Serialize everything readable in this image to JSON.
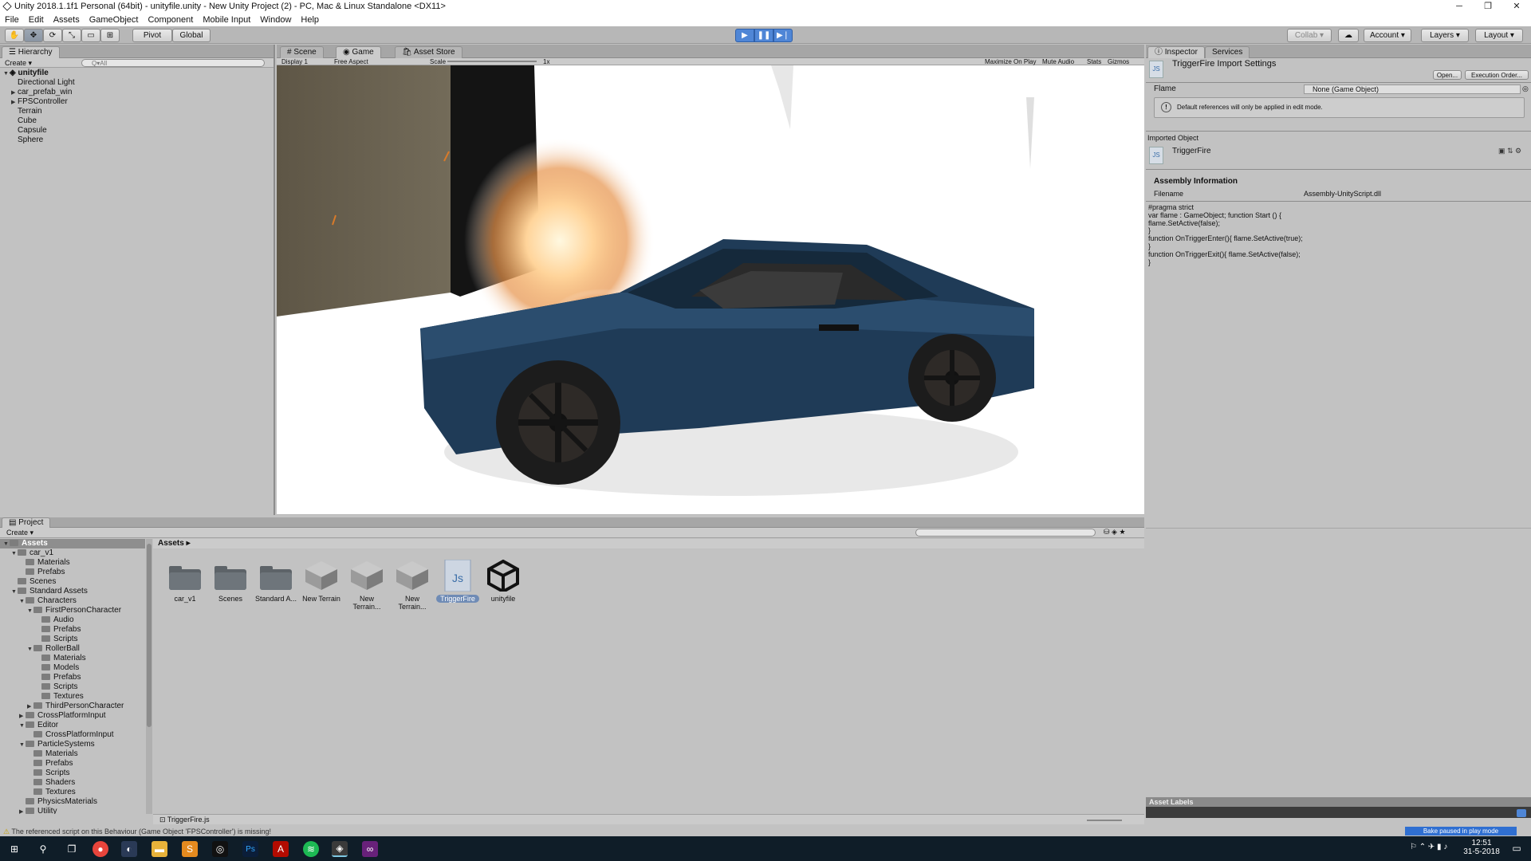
{
  "window": {
    "title": "Unity 2018.1.1f1 Personal (64bit) - unityfile.unity - New Unity Project (2) - PC, Mac & Linux Standalone <DX11>",
    "minimize": "─",
    "restore": "❐",
    "close": "✕"
  },
  "menu": [
    "File",
    "Edit",
    "Assets",
    "GameObject",
    "Component",
    "Mobile Input",
    "Window",
    "Help"
  ],
  "toolbar": {
    "pivot": "Pivot",
    "global": "Global",
    "collab": "Collab ▾",
    "account": "Account",
    "layers": "Layers",
    "layout": "Layout"
  },
  "hierarchy": {
    "tab": "Hierarchy",
    "create": "Create ▾",
    "search_placeholder": "Q▾All",
    "scene": "unityfile",
    "items": [
      {
        "label": "Directional Light",
        "expandable": false
      },
      {
        "label": "car_prefab_win",
        "expandable": true
      },
      {
        "label": "FPSController",
        "expandable": true
      },
      {
        "label": "Terrain",
        "expandable": false
      },
      {
        "label": "Cube",
        "expandable": false
      },
      {
        "label": "Capsule",
        "expandable": false
      },
      {
        "label": "Sphere",
        "expandable": false
      }
    ]
  },
  "scene_tabs": {
    "scene": "Scene",
    "game": "Game",
    "asset_store": "Asset Store"
  },
  "game_bar": {
    "display": "Display 1",
    "aspect": "Free Aspect",
    "scale_label": "Scale",
    "scale_value": "1x",
    "maximize": "Maximize On Play",
    "mute": "Mute Audio",
    "stats": "Stats",
    "gizmos": "Gizmos"
  },
  "inspector": {
    "tab": "Inspector",
    "services_tab": "Services",
    "title": "TriggerFire Import Settings",
    "open": "Open...",
    "exec_order": "Execution Order...",
    "flame_label": "Flame",
    "flame_value": "None (Game Object)",
    "info": "Default references will only be applied in edit mode.",
    "imported_object": "Imported Object",
    "object_name": "TriggerFire",
    "assembly_header": "Assembly Information",
    "filename_label": "Filename",
    "filename_value": "Assembly-UnityScript.dll",
    "code": "#pragma strict\nvar flame : GameObject; function Start () {\nflame.SetActive(false);\n}\nfunction OnTriggerEnter(){ flame.SetActive(true);\n}\nfunction OnTriggerExit(){ flame.SetActive(false);\n}",
    "asset_labels": "Asset Labels",
    "bake": "Bake paused in play mode"
  },
  "project": {
    "tab": "Project",
    "create": "Create ▾",
    "breadcrumb": "Assets ▸",
    "selected_file": "TriggerFire.js",
    "tree": [
      {
        "label": "Assets",
        "depth": 0,
        "arrow": "▼",
        "selected": true
      },
      {
        "label": "car_v1",
        "depth": 1,
        "arrow": "▼"
      },
      {
        "label": "Materials",
        "depth": 2,
        "arrow": ""
      },
      {
        "label": "Prefabs",
        "depth": 2,
        "arrow": ""
      },
      {
        "label": "Scenes",
        "depth": 1,
        "arrow": ""
      },
      {
        "label": "Standard Assets",
        "depth": 1,
        "arrow": "▼"
      },
      {
        "label": "Characters",
        "depth": 2,
        "arrow": "▼"
      },
      {
        "label": "FirstPersonCharacter",
        "depth": 3,
        "arrow": "▼"
      },
      {
        "label": "Audio",
        "depth": 4,
        "arrow": ""
      },
      {
        "label": "Prefabs",
        "depth": 4,
        "arrow": ""
      },
      {
        "label": "Scripts",
        "depth": 4,
        "arrow": ""
      },
      {
        "label": "RollerBall",
        "depth": 3,
        "arrow": "▼"
      },
      {
        "label": "Materials",
        "depth": 4,
        "arrow": ""
      },
      {
        "label": "Models",
        "depth": 4,
        "arrow": ""
      },
      {
        "label": "Prefabs",
        "depth": 4,
        "arrow": ""
      },
      {
        "label": "Scripts",
        "depth": 4,
        "arrow": ""
      },
      {
        "label": "Textures",
        "depth": 4,
        "arrow": ""
      },
      {
        "label": "ThirdPersonCharacter",
        "depth": 3,
        "arrow": "▶"
      },
      {
        "label": "CrossPlatformInput",
        "depth": 2,
        "arrow": "▶"
      },
      {
        "label": "Editor",
        "depth": 2,
        "arrow": "▼"
      },
      {
        "label": "CrossPlatformInput",
        "depth": 3,
        "arrow": ""
      },
      {
        "label": "ParticleSystems",
        "depth": 2,
        "arrow": "▼"
      },
      {
        "label": "Materials",
        "depth": 3,
        "arrow": ""
      },
      {
        "label": "Prefabs",
        "depth": 3,
        "arrow": ""
      },
      {
        "label": "Scripts",
        "depth": 3,
        "arrow": ""
      },
      {
        "label": "Shaders",
        "depth": 3,
        "arrow": ""
      },
      {
        "label": "Textures",
        "depth": 3,
        "arrow": ""
      },
      {
        "label": "PhysicsMaterials",
        "depth": 2,
        "arrow": ""
      },
      {
        "label": "Utility",
        "depth": 2,
        "arrow": "▶"
      }
    ],
    "assets": [
      {
        "label": "car_v1",
        "kind": "folder"
      },
      {
        "label": "Scenes",
        "kind": "folder"
      },
      {
        "label": "Standard A...",
        "kind": "folder"
      },
      {
        "label": "New Terrain",
        "kind": "terrain"
      },
      {
        "label": "New Terrain...",
        "kind": "terrain"
      },
      {
        "label": "New Terrain...",
        "kind": "terrain"
      },
      {
        "label": "TriggerFire",
        "kind": "script"
      },
      {
        "label": "unityfile",
        "kind": "unity"
      }
    ]
  },
  "status": "The referenced script on this Behaviour (Game Object 'FPSController') is missing!",
  "taskbar": {
    "time": "12:51",
    "date": "31-5-2018"
  },
  "colors": {
    "play_blue": "#4f86d6",
    "car_blue": "#1f3b57"
  }
}
